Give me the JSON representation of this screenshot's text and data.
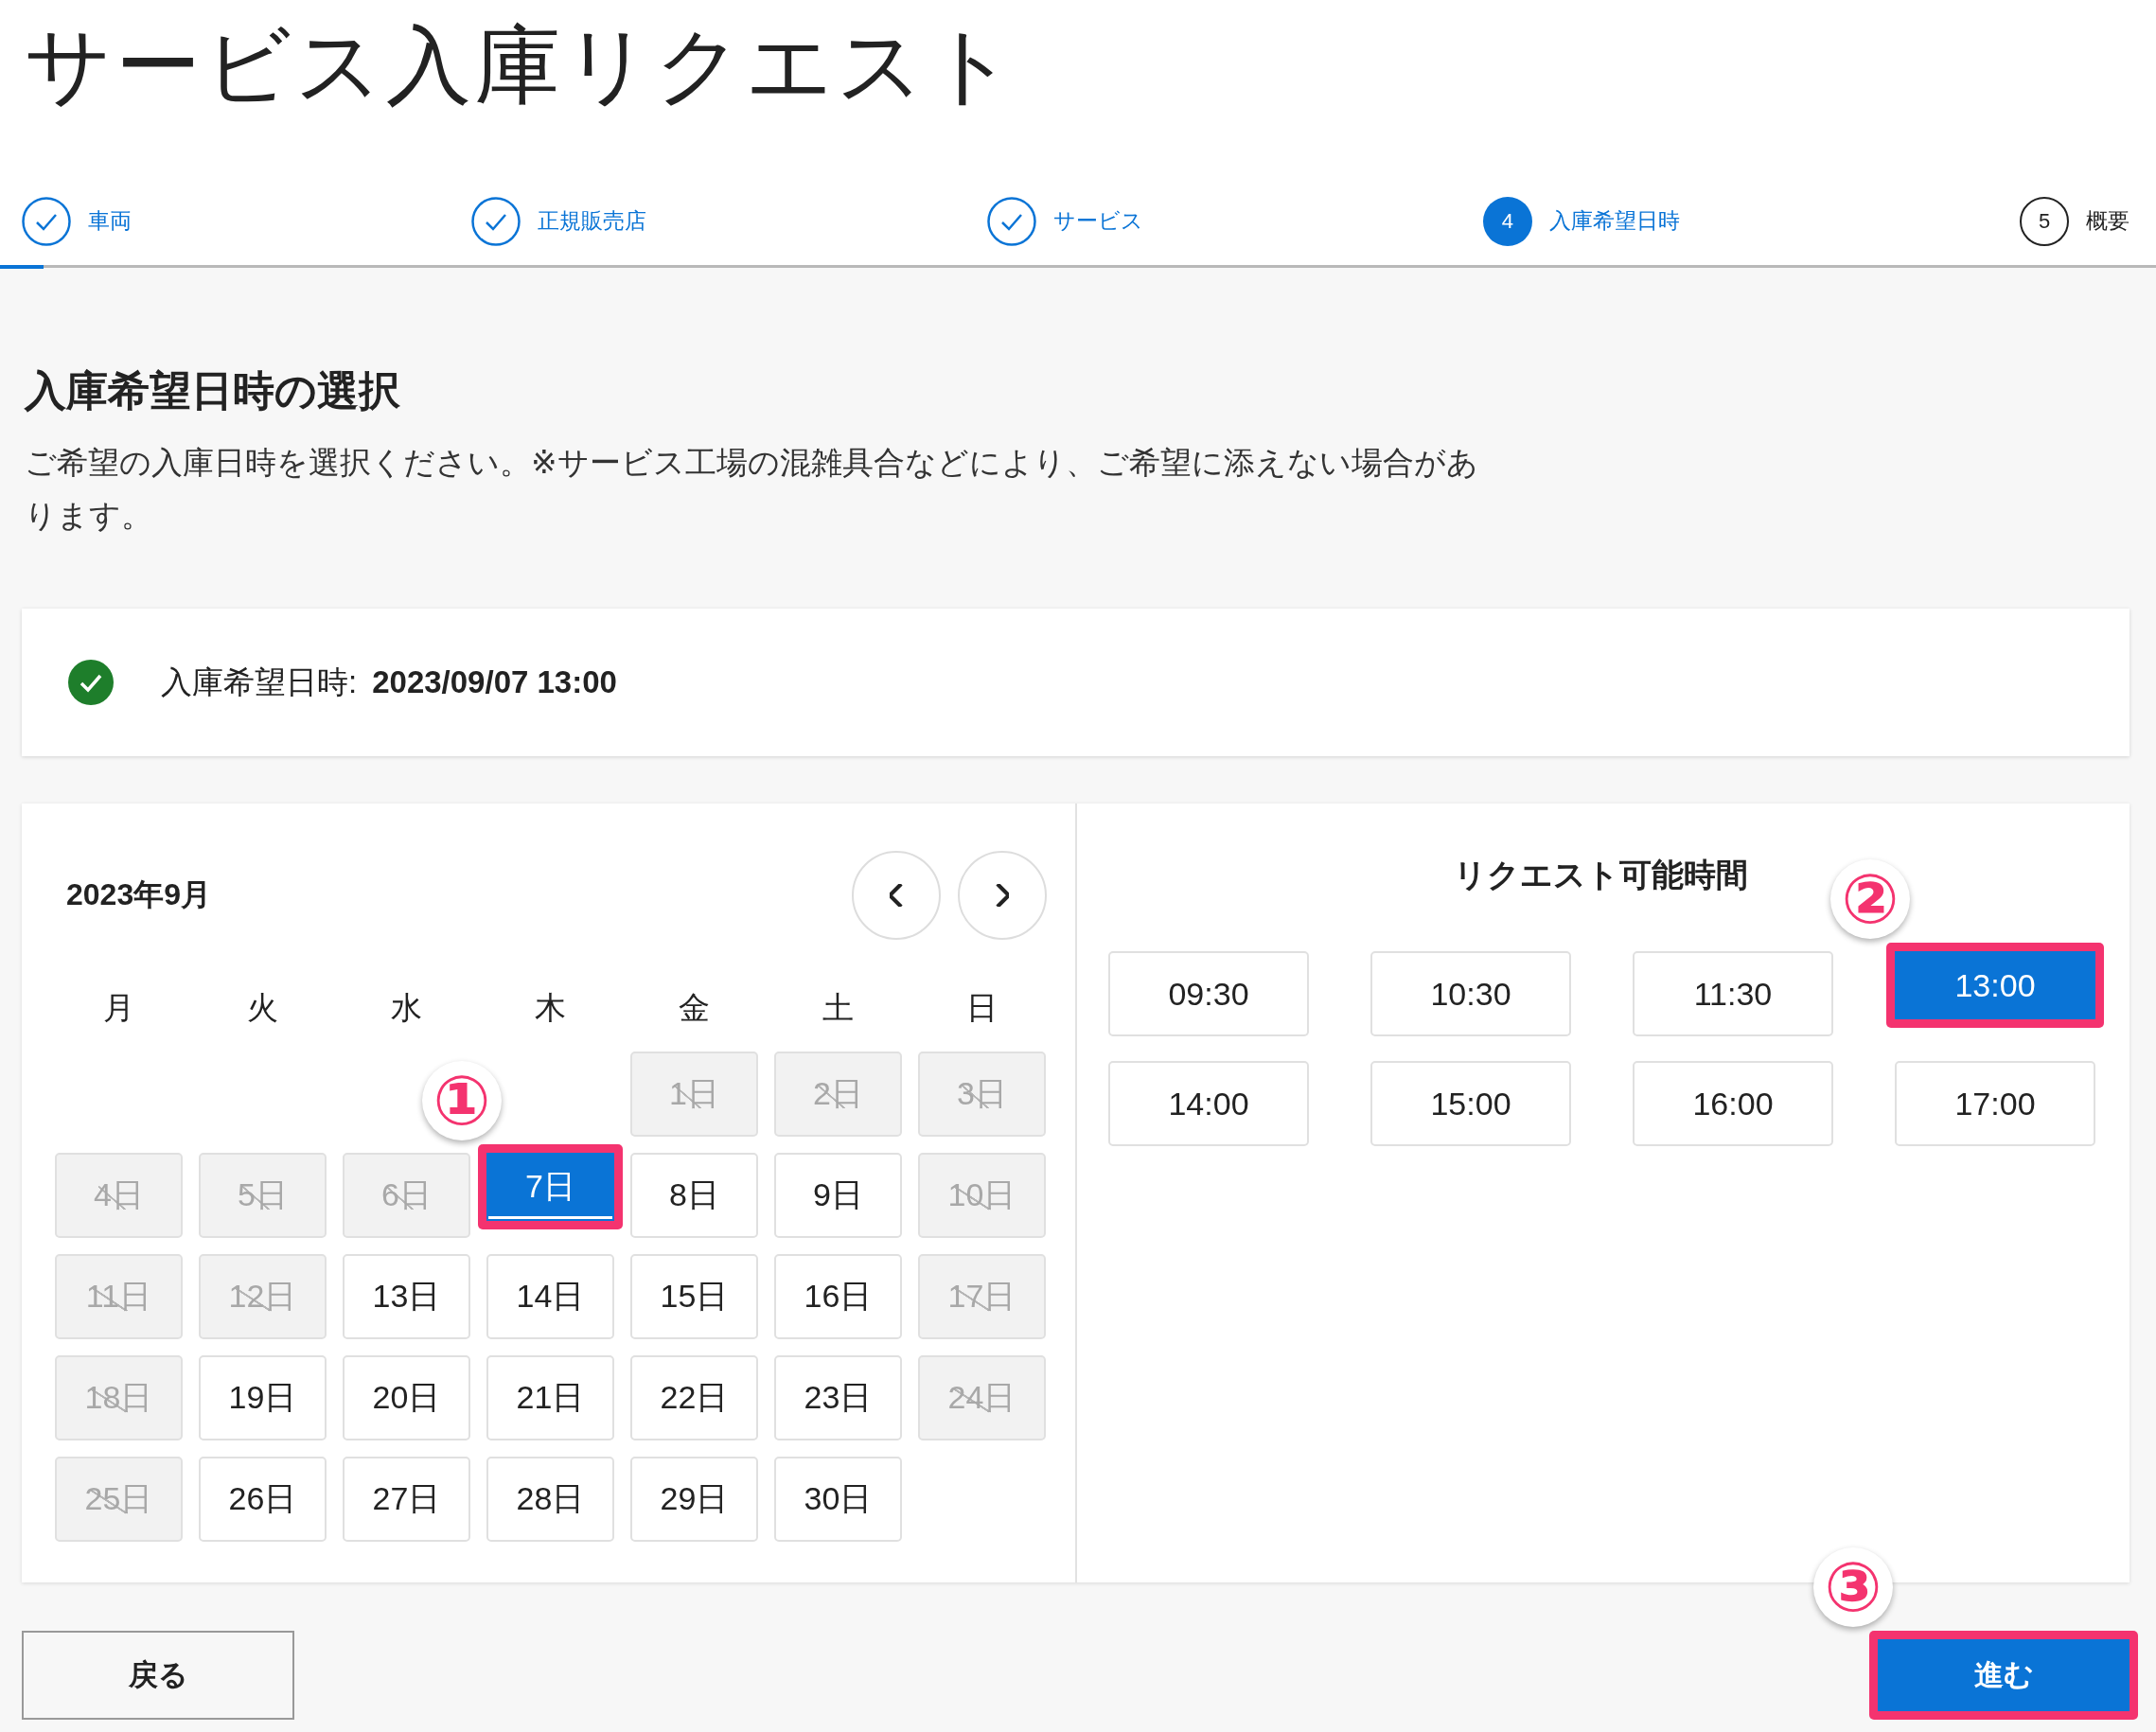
{
  "page_title": "サービス入庫リクエスト",
  "steps": [
    {
      "label": "車両",
      "done": true,
      "active": false
    },
    {
      "label": "正規販売店",
      "done": true,
      "active": false
    },
    {
      "label": "サービス",
      "done": true,
      "active": false
    },
    {
      "label": "入庫希望日時",
      "done": false,
      "active": true,
      "number": "4"
    },
    {
      "label": "概要",
      "done": false,
      "active": false,
      "number": "5"
    }
  ],
  "section": {
    "heading": "入庫希望日時の選択",
    "description": "ご希望の入庫日時を選択ください。※サービス工場の混雑具合などにより、ご希望に添えない場合があります。"
  },
  "summary": {
    "done": true,
    "label": "入庫希望日時:",
    "value": "2023/09/07 13:00"
  },
  "calendar": {
    "month": "2023年9月",
    "weekdays": [
      "月",
      "火",
      "水",
      "木",
      "金",
      "土",
      "日"
    ],
    "weeks": [
      [
        {
          "kind": "empty"
        },
        {
          "kind": "empty"
        },
        {
          "kind": "empty"
        },
        {
          "kind": "empty"
        },
        {
          "kind": "day",
          "label": "1日",
          "disabled": true,
          "selected": false
        },
        {
          "kind": "day",
          "label": "2日",
          "disabled": true,
          "selected": false
        },
        {
          "kind": "day",
          "label": "3日",
          "disabled": true,
          "selected": false
        }
      ],
      [
        {
          "kind": "day",
          "label": "4日",
          "disabled": true,
          "selected": false
        },
        {
          "kind": "day",
          "label": "5日",
          "disabled": true,
          "selected": false
        },
        {
          "kind": "day",
          "label": "6日",
          "disabled": true,
          "selected": false
        },
        {
          "kind": "day",
          "label": "7日",
          "disabled": false,
          "selected": true,
          "marker": "①"
        },
        {
          "kind": "day",
          "label": "8日",
          "disabled": false,
          "selected": false
        },
        {
          "kind": "day",
          "label": "9日",
          "disabled": false,
          "selected": false
        },
        {
          "kind": "day",
          "label": "10日",
          "disabled": true,
          "selected": false
        }
      ],
      [
        {
          "kind": "day",
          "label": "11日",
          "disabled": true,
          "selected": false
        },
        {
          "kind": "day",
          "label": "12日",
          "disabled": true,
          "selected": false
        },
        {
          "kind": "day",
          "label": "13日",
          "disabled": false,
          "selected": false
        },
        {
          "kind": "day",
          "label": "14日",
          "disabled": false,
          "selected": false
        },
        {
          "kind": "day",
          "label": "15日",
          "disabled": false,
          "selected": false
        },
        {
          "kind": "day",
          "label": "16日",
          "disabled": false,
          "selected": false
        },
        {
          "kind": "day",
          "label": "17日",
          "disabled": true,
          "selected": false
        }
      ],
      [
        {
          "kind": "day",
          "label": "18日",
          "disabled": true,
          "selected": false
        },
        {
          "kind": "day",
          "label": "19日",
          "disabled": false,
          "selected": false
        },
        {
          "kind": "day",
          "label": "20日",
          "disabled": false,
          "selected": false
        },
        {
          "kind": "day",
          "label": "21日",
          "disabled": false,
          "selected": false
        },
        {
          "kind": "day",
          "label": "22日",
          "disabled": false,
          "selected": false
        },
        {
          "kind": "day",
          "label": "23日",
          "disabled": false,
          "selected": false
        },
        {
          "kind": "day",
          "label": "24日",
          "disabled": true,
          "selected": false
        }
      ],
      [
        {
          "kind": "day",
          "label": "25日",
          "disabled": true,
          "selected": false
        },
        {
          "kind": "day",
          "label": "26日",
          "disabled": false,
          "selected": false
        },
        {
          "kind": "day",
          "label": "27日",
          "disabled": false,
          "selected": false
        },
        {
          "kind": "day",
          "label": "28日",
          "disabled": false,
          "selected": false
        },
        {
          "kind": "day",
          "label": "29日",
          "disabled": false,
          "selected": false
        },
        {
          "kind": "day",
          "label": "30日",
          "disabled": false,
          "selected": false
        },
        {
          "kind": "empty"
        }
      ]
    ]
  },
  "times": {
    "title": "リクエスト可能時間",
    "slots": [
      {
        "label": "09:30",
        "selected": false
      },
      {
        "label": "10:30",
        "selected": false
      },
      {
        "label": "11:30",
        "selected": false
      },
      {
        "label": "13:00",
        "selected": true,
        "marker": "②"
      },
      {
        "label": "14:00",
        "selected": false
      },
      {
        "label": "15:00",
        "selected": false
      },
      {
        "label": "16:00",
        "selected": false
      },
      {
        "label": "17:00",
        "selected": false
      }
    ]
  },
  "buttons": {
    "back": {
      "label": "戻る"
    },
    "next": {
      "label": "進む",
      "marker": "③"
    }
  }
}
